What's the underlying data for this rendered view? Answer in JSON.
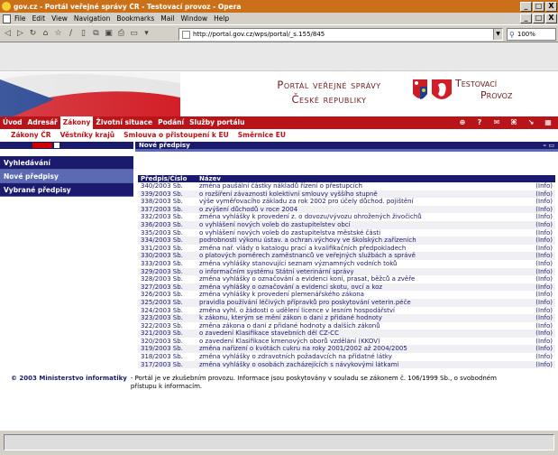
{
  "window": {
    "title": "gov.cz - Portál veřejné správy ČR - Testovací provoz - Opera",
    "minimize": "_",
    "maximize": "□",
    "close": "X"
  },
  "menu": [
    "File",
    "Edit",
    "View",
    "Navigation",
    "Bookmarks",
    "Mail",
    "Window",
    "Help"
  ],
  "address": {
    "url": "http://portal.gov.cz/wps/portal/_s.155/845",
    "zoom": "100%"
  },
  "banner": {
    "title_line1": "Portál veřejné správy",
    "title_line2": "České republiky",
    "test_line1": "Testovací",
    "test_line2": "Provoz"
  },
  "topnav": {
    "items": [
      "Úvod",
      "Adresář",
      "Zákony",
      "Životní situace",
      "Podání",
      "Služby portálu"
    ]
  },
  "subnav": [
    "Zákony ČR",
    "Věstníky krajů",
    "Smlouva o přistoupení k EU",
    "Směrnice EU"
  ],
  "sidebar": [
    "Vyhledávání",
    "Nové předpisy",
    "Vybrané předpisy"
  ],
  "portlet": {
    "title": "Nové předpisy",
    "controls": "– ▭"
  },
  "table": {
    "headers": [
      "Předpis/Číslo",
      "Název",
      ""
    ],
    "rows": [
      [
        "340/2003 Sb.",
        "změna paušální částky nákladů řízení o přestupcích",
        "(Info)"
      ],
      [
        "339/2003 Sb.",
        "o rozšíření závaznosti kolektivní smlouvy vyššího stupně",
        "(Info)"
      ],
      [
        "338/2003 Sb.",
        "výše vyměřovacího základu za rok 2002 pro účely důchod. pojištění",
        "(Info)"
      ],
      [
        "337/2003 Sb.",
        "o zvýšení důchodů v roce 2004",
        "(Info)"
      ],
      [
        "332/2003 Sb.",
        "změna vyhlášky k provedení z. o dovozu/vývozu ohrožených živočichů",
        "(Info)"
      ],
      [
        "336/2003 Sb.",
        "o vyhlášení nových voleb do zastupitelstev obcí",
        "(Info)"
      ],
      [
        "335/2003 Sb.",
        "o vyhlášení nových voleb do zastupitelstva městské části",
        "(Info)"
      ],
      [
        "334/2003 Sb.",
        "podrobnosti výkonu ústav. a ochran.výchovy ve školských zařízeních",
        "(Info)"
      ],
      [
        "331/2003 Sb.",
        "změna nař. vlády o katalogu prací a kvalifikačních předpokladech",
        "(Info)"
      ],
      [
        "330/2003 Sb.",
        "o platových poměrech zaměstnanců ve veřejných službách a správě",
        "(Info)"
      ],
      [
        "333/2003 Sb.",
        "změna vyhlášky stanovující seznam významných vodních toků",
        "(Info)"
      ],
      [
        "329/2003 Sb.",
        "o informačním systému Státní veterinární správy",
        "(Info)"
      ],
      [
        "328/2003 Sb.",
        "změna vyhlášky o označování a evidenci koní, prasat, běžců a zvěře",
        "(Info)"
      ],
      [
        "327/2003 Sb.",
        "změna vyhlášky o označování a evidenci skotu, ovcí a koz",
        "(Info)"
      ],
      [
        "326/2003 Sb.",
        "změna vyhlášky k provedení plemenářského zákona",
        "(Info)"
      ],
      [
        "325/2003 Sb.",
        "pravidla používání léčivých přípravků pro poskytování veterin.péče",
        "(Info)"
      ],
      [
        "324/2003 Sb.",
        "změna vyhl. o žádosti o udělení licence v lesním hospodářství",
        "(Info)"
      ],
      [
        "323/2003 Sb.",
        "k zákonu, kterým se mění zákon o dani z přidané hodnoty",
        "(Info)"
      ],
      [
        "322/2003 Sb.",
        "změna zákona o dani z přidané hodnoty a dalších zákonů",
        "(Info)"
      ],
      [
        "321/2003 Sb.",
        "o zavedení Klasifikace stavebních děl CZ-CC",
        "(Info)"
      ],
      [
        "320/2003 Sb.",
        "o zavedení Klasifikace kmenových oborů vzdělání (KKOV)",
        "(Info)"
      ],
      [
        "319/2003 Sb.",
        "změna nařízení o kvótách cukru na roky 2001/2002 až 2004/2005",
        "(Info)"
      ],
      [
        "318/2003 Sb.",
        "změna vyhlášky o zdravotních požadavcích na přídatné látky",
        "(Info)"
      ],
      [
        "317/2003 Sb.",
        "změna vyhlášky o osobách zacházejících s návykovými látkami",
        "(Info)"
      ]
    ]
  },
  "footer": {
    "copyright": "© 2003 Ministerstvo informatiky",
    "note": "- Portál je ve zkušebním provozu. Informace jsou poskytovány v souladu se zákonem č. 106/1999 Sb., o svobodném přístupu k informacím."
  },
  "colors": {
    "navy": "#1a1a6e",
    "red": "#b8141a",
    "title_brown": "#6e2020"
  }
}
